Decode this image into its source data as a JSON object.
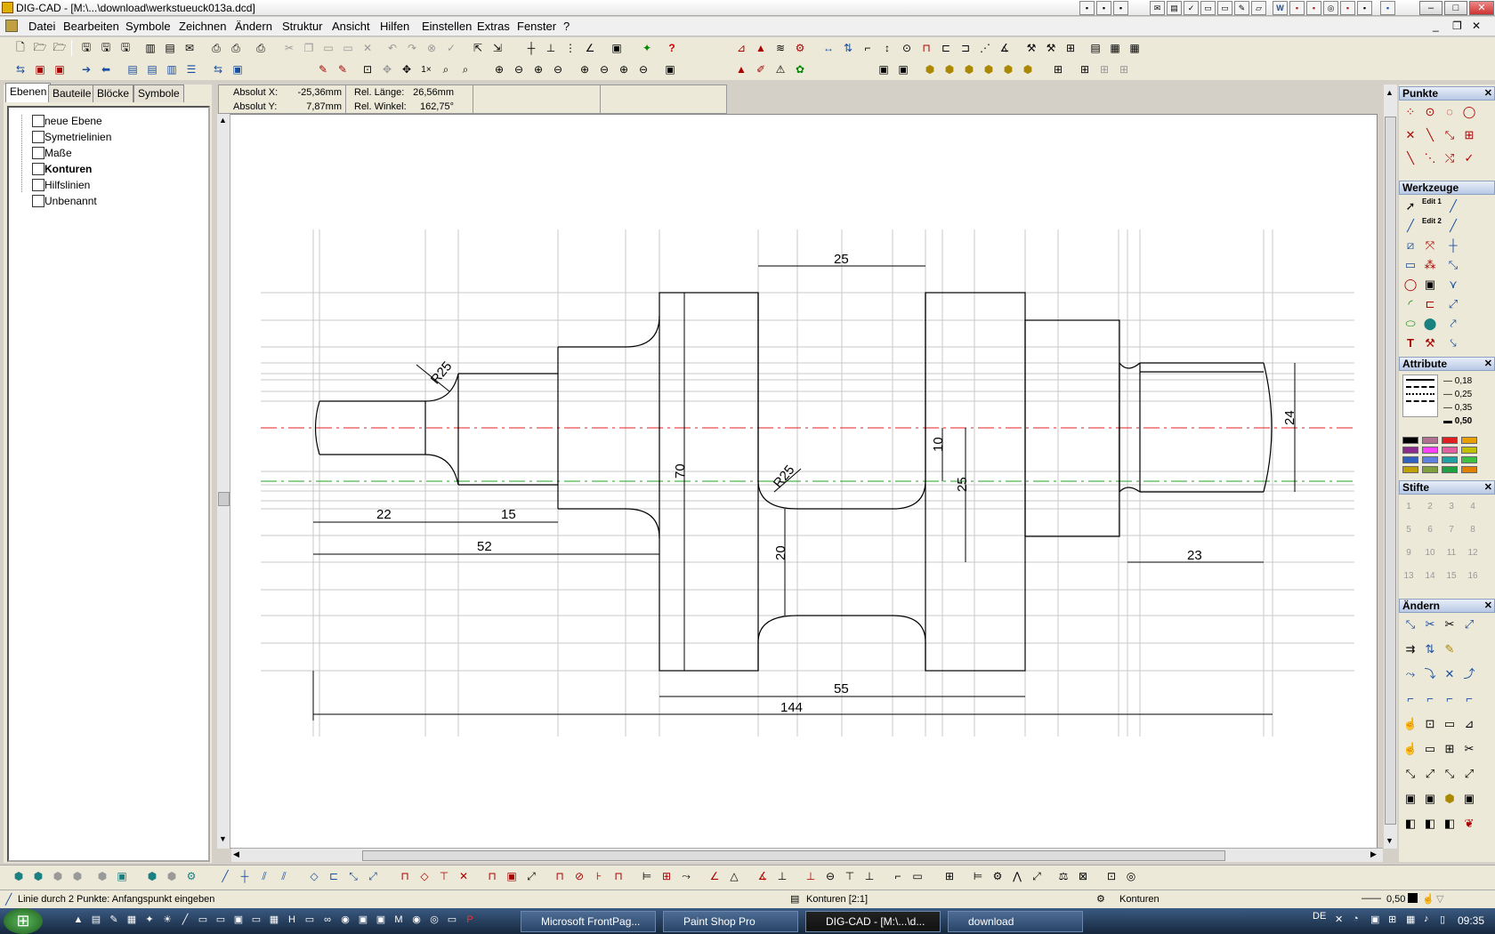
{
  "window": {
    "title": "DIG-CAD - [M:\\...\\download\\werkstueuck013a.dcd]"
  },
  "menu": [
    "Datei",
    "Bearbeiten",
    "Symbole",
    "Zeichnen",
    "Ändern",
    "Struktur",
    "Ansicht",
    "Hilfen",
    "Einstellen",
    "Extras",
    "Fenster",
    "?"
  ],
  "toolbar": {
    "zoom_label": "1×",
    "help": "?"
  },
  "left_panel": {
    "tabs": [
      "Ebenen",
      "Bauteile",
      "Blöcke",
      "Symbole"
    ],
    "layers": [
      {
        "name": "neue Ebene",
        "bold": false
      },
      {
        "name": "Symetrielinien",
        "bold": false
      },
      {
        "name": "Maße",
        "bold": false
      },
      {
        "name": "Konturen",
        "bold": true
      },
      {
        "name": "Hilfslinien",
        "bold": false
      },
      {
        "name": "Unbenannt",
        "bold": false
      }
    ]
  },
  "coords": {
    "abs_x_label": "Absolut X:",
    "abs_x": "-25,36mm",
    "abs_y_label": "Absolut Y:",
    "abs_y": "7,87mm",
    "rel_len_label": "Rel. Länge:",
    "rel_len": "26,56mm",
    "rel_ang_label": "Rel. Winkel:",
    "rel_ang": "162,75°"
  },
  "dimensions": {
    "d25_top": "25",
    "r25_left": "R25",
    "r25_mid": "R25",
    "d70": "70",
    "d22": "22",
    "d15": "15",
    "d52": "52",
    "d20": "20",
    "d10": "10",
    "d25_right": "25",
    "d24": "24",
    "d23": "23",
    "d55": "55",
    "d144": "144"
  },
  "right_panel": {
    "punkte": "Punkte",
    "werkzeuge": "Werkzeuge",
    "edit1": "Edit 1",
    "edit2": "Edit 2",
    "attribute": "Attribute",
    "line_widths": [
      "0,18",
      "0,25",
      "0,35",
      "0,50"
    ],
    "stifte": "Stifte",
    "pens": [
      "1",
      "2",
      "3",
      "4",
      "5",
      "6",
      "7",
      "8",
      "9",
      "10",
      "11",
      "12",
      "13",
      "14",
      "15",
      "16"
    ],
    "aendern": "Ändern",
    "colors": [
      "#000000",
      "#b07090",
      "#e02020",
      "#e8a000",
      "#8c2c8c",
      "#ff40ff",
      "#e060a0",
      "#c0c000",
      "#3060c0",
      "#6080e0",
      "#20a0a0",
      "#40c040",
      "#c0a000",
      "#80a040",
      "#20a040",
      "#e08000"
    ]
  },
  "status": {
    "hint": "Linie durch 2 Punkte: Anfangspunkt eingeben",
    "layer": "Konturen [2:1]",
    "layer2": "Konturen",
    "linewidth": "0,50"
  },
  "taskbar": {
    "tasks": [
      "Microsoft FrontPag...",
      "Paint Shop Pro",
      "DIG-CAD - [M:\\...\\d...",
      "download"
    ],
    "lang": "DE",
    "clock": "09:35"
  }
}
